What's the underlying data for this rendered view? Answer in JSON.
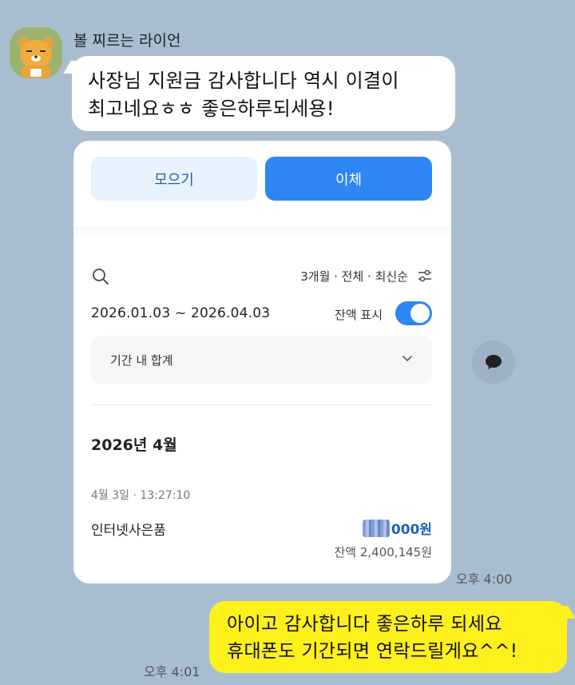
{
  "chat": {
    "sender_name": "볼 찌르는 라이언",
    "incoming_message_line1": "사장님 지원금 감사합니다 역시 이결이",
    "incoming_message_line2": "최고네요ㅎㅎ 좋은하루되세용!",
    "incoming_time": "오후 4:00",
    "outgoing_message_line1": "아이고 감사합니다 좋은하루 되세요",
    "outgoing_message_line2": "휴대폰도 기간되면 연락드릴게요^^!",
    "outgoing_time": "오후 4:01"
  },
  "bank_card": {
    "tabs": {
      "save_label": "모으기",
      "transfer_label": "이체"
    },
    "filter_summary": "3개월 · 전체 · 최신순",
    "date_range": "2026.01.03 ~ 2026.04.03",
    "show_balance_label": "잔액 표시",
    "show_balance_on": true,
    "period_total_label": "기간 내 합계",
    "month_title": "2026년 4월",
    "transaction": {
      "time": "4월 3일 · 13:27:10",
      "name": "인터넷사은품",
      "amount_visible": "000원",
      "balance": "잔액 2,400,145원"
    }
  },
  "icons": {
    "avatar": "ryan-character-avatar",
    "search": "search-icon",
    "filter": "sliders-icon",
    "chevron": "chevron-down-icon",
    "share": "speech-bubble-icon"
  },
  "colors": {
    "chat_bg": "#a9bdd1",
    "incoming_bubble": "#ffffff",
    "outgoing_bubble": "#fef01b",
    "accent_blue": "#2d86f3"
  }
}
